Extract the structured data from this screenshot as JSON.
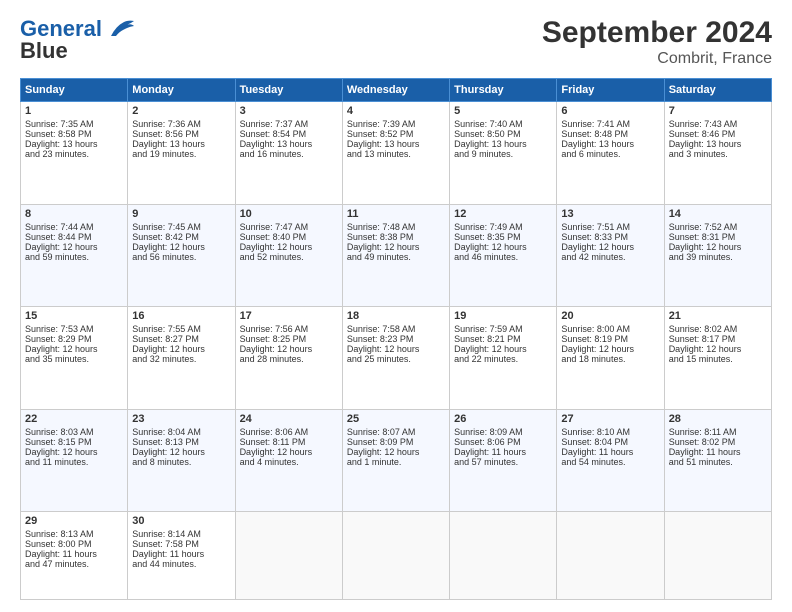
{
  "header": {
    "logo_line1": "General",
    "logo_line2": "Blue",
    "title": "September 2024",
    "subtitle": "Combrit, France"
  },
  "columns": [
    "Sunday",
    "Monday",
    "Tuesday",
    "Wednesday",
    "Thursday",
    "Friday",
    "Saturday"
  ],
  "rows": [
    [
      {
        "day": "1",
        "lines": [
          "Sunrise: 7:35 AM",
          "Sunset: 8:58 PM",
          "Daylight: 13 hours",
          "and 23 minutes."
        ]
      },
      {
        "day": "2",
        "lines": [
          "Sunrise: 7:36 AM",
          "Sunset: 8:56 PM",
          "Daylight: 13 hours",
          "and 19 minutes."
        ]
      },
      {
        "day": "3",
        "lines": [
          "Sunrise: 7:37 AM",
          "Sunset: 8:54 PM",
          "Daylight: 13 hours",
          "and 16 minutes."
        ]
      },
      {
        "day": "4",
        "lines": [
          "Sunrise: 7:39 AM",
          "Sunset: 8:52 PM",
          "Daylight: 13 hours",
          "and 13 minutes."
        ]
      },
      {
        "day": "5",
        "lines": [
          "Sunrise: 7:40 AM",
          "Sunset: 8:50 PM",
          "Daylight: 13 hours",
          "and 9 minutes."
        ]
      },
      {
        "day": "6",
        "lines": [
          "Sunrise: 7:41 AM",
          "Sunset: 8:48 PM",
          "Daylight: 13 hours",
          "and 6 minutes."
        ]
      },
      {
        "day": "7",
        "lines": [
          "Sunrise: 7:43 AM",
          "Sunset: 8:46 PM",
          "Daylight: 13 hours",
          "and 3 minutes."
        ]
      }
    ],
    [
      {
        "day": "8",
        "lines": [
          "Sunrise: 7:44 AM",
          "Sunset: 8:44 PM",
          "Daylight: 12 hours",
          "and 59 minutes."
        ]
      },
      {
        "day": "9",
        "lines": [
          "Sunrise: 7:45 AM",
          "Sunset: 8:42 PM",
          "Daylight: 12 hours",
          "and 56 minutes."
        ]
      },
      {
        "day": "10",
        "lines": [
          "Sunrise: 7:47 AM",
          "Sunset: 8:40 PM",
          "Daylight: 12 hours",
          "and 52 minutes."
        ]
      },
      {
        "day": "11",
        "lines": [
          "Sunrise: 7:48 AM",
          "Sunset: 8:38 PM",
          "Daylight: 12 hours",
          "and 49 minutes."
        ]
      },
      {
        "day": "12",
        "lines": [
          "Sunrise: 7:49 AM",
          "Sunset: 8:35 PM",
          "Daylight: 12 hours",
          "and 46 minutes."
        ]
      },
      {
        "day": "13",
        "lines": [
          "Sunrise: 7:51 AM",
          "Sunset: 8:33 PM",
          "Daylight: 12 hours",
          "and 42 minutes."
        ]
      },
      {
        "day": "14",
        "lines": [
          "Sunrise: 7:52 AM",
          "Sunset: 8:31 PM",
          "Daylight: 12 hours",
          "and 39 minutes."
        ]
      }
    ],
    [
      {
        "day": "15",
        "lines": [
          "Sunrise: 7:53 AM",
          "Sunset: 8:29 PM",
          "Daylight: 12 hours",
          "and 35 minutes."
        ]
      },
      {
        "day": "16",
        "lines": [
          "Sunrise: 7:55 AM",
          "Sunset: 8:27 PM",
          "Daylight: 12 hours",
          "and 32 minutes."
        ]
      },
      {
        "day": "17",
        "lines": [
          "Sunrise: 7:56 AM",
          "Sunset: 8:25 PM",
          "Daylight: 12 hours",
          "and 28 minutes."
        ]
      },
      {
        "day": "18",
        "lines": [
          "Sunrise: 7:58 AM",
          "Sunset: 8:23 PM",
          "Daylight: 12 hours",
          "and 25 minutes."
        ]
      },
      {
        "day": "19",
        "lines": [
          "Sunrise: 7:59 AM",
          "Sunset: 8:21 PM",
          "Daylight: 12 hours",
          "and 22 minutes."
        ]
      },
      {
        "day": "20",
        "lines": [
          "Sunrise: 8:00 AM",
          "Sunset: 8:19 PM",
          "Daylight: 12 hours",
          "and 18 minutes."
        ]
      },
      {
        "day": "21",
        "lines": [
          "Sunrise: 8:02 AM",
          "Sunset: 8:17 PM",
          "Daylight: 12 hours",
          "and 15 minutes."
        ]
      }
    ],
    [
      {
        "day": "22",
        "lines": [
          "Sunrise: 8:03 AM",
          "Sunset: 8:15 PM",
          "Daylight: 12 hours",
          "and 11 minutes."
        ]
      },
      {
        "day": "23",
        "lines": [
          "Sunrise: 8:04 AM",
          "Sunset: 8:13 PM",
          "Daylight: 12 hours",
          "and 8 minutes."
        ]
      },
      {
        "day": "24",
        "lines": [
          "Sunrise: 8:06 AM",
          "Sunset: 8:11 PM",
          "Daylight: 12 hours",
          "and 4 minutes."
        ]
      },
      {
        "day": "25",
        "lines": [
          "Sunrise: 8:07 AM",
          "Sunset: 8:09 PM",
          "Daylight: 12 hours",
          "and 1 minute."
        ]
      },
      {
        "day": "26",
        "lines": [
          "Sunrise: 8:09 AM",
          "Sunset: 8:06 PM",
          "Daylight: 11 hours",
          "and 57 minutes."
        ]
      },
      {
        "day": "27",
        "lines": [
          "Sunrise: 8:10 AM",
          "Sunset: 8:04 PM",
          "Daylight: 11 hours",
          "and 54 minutes."
        ]
      },
      {
        "day": "28",
        "lines": [
          "Sunrise: 8:11 AM",
          "Sunset: 8:02 PM",
          "Daylight: 11 hours",
          "and 51 minutes."
        ]
      }
    ],
    [
      {
        "day": "29",
        "lines": [
          "Sunrise: 8:13 AM",
          "Sunset: 8:00 PM",
          "Daylight: 11 hours",
          "and 47 minutes."
        ]
      },
      {
        "day": "30",
        "lines": [
          "Sunrise: 8:14 AM",
          "Sunset: 7:58 PM",
          "Daylight: 11 hours",
          "and 44 minutes."
        ]
      },
      {
        "day": "",
        "lines": []
      },
      {
        "day": "",
        "lines": []
      },
      {
        "day": "",
        "lines": []
      },
      {
        "day": "",
        "lines": []
      },
      {
        "day": "",
        "lines": []
      }
    ]
  ]
}
